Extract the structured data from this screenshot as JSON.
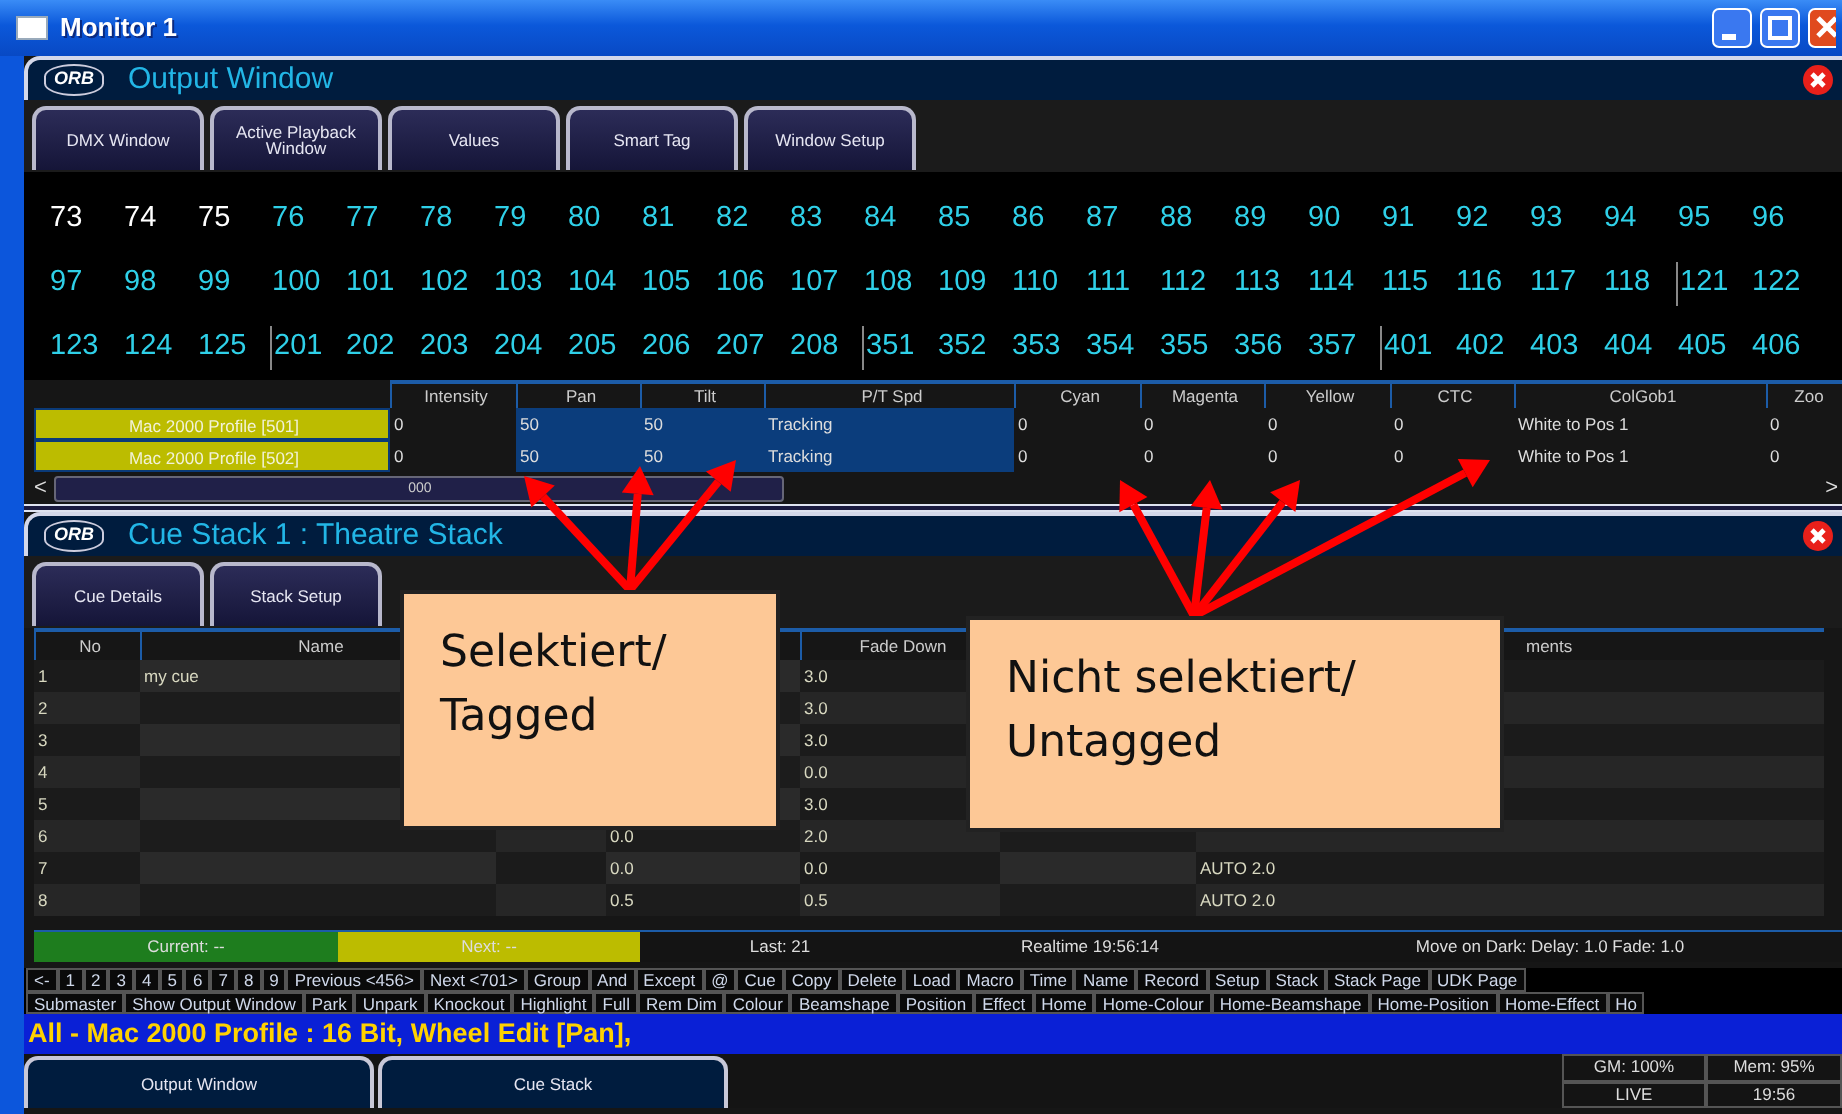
{
  "window": {
    "title": "Monitor 1"
  },
  "output_window": {
    "logo": "ORB",
    "title": "Output Window",
    "buttons": [
      "DMX Window",
      "Active Playback Window",
      "Values",
      "Smart Tag",
      "Window Setup"
    ],
    "channel_rows": [
      [
        {
          "n": "73",
          "color": "#ffffff"
        },
        {
          "n": "74",
          "color": "#ffffff"
        },
        {
          "n": "75",
          "color": "#ffffff"
        },
        {
          "n": "76",
          "color": "#2fd0e8"
        },
        {
          "n": "77",
          "color": "#2fd0e8"
        },
        {
          "n": "78",
          "color": "#2fd0e8"
        },
        {
          "n": "79",
          "color": "#2fd0e8"
        },
        {
          "n": "80",
          "color": "#2fd0e8"
        },
        {
          "n": "81",
          "color": "#2fd0e8"
        },
        {
          "n": "82",
          "color": "#2fd0e8"
        },
        {
          "n": "83",
          "color": "#2fd0e8"
        },
        {
          "n": "84",
          "color": "#2fd0e8"
        },
        {
          "n": "85",
          "color": "#2fd0e8"
        },
        {
          "n": "86",
          "color": "#2fd0e8"
        },
        {
          "n": "87",
          "color": "#2fd0e8"
        },
        {
          "n": "88",
          "color": "#2fd0e8"
        },
        {
          "n": "89",
          "color": "#2fd0e8"
        },
        {
          "n": "90",
          "color": "#2fd0e8"
        },
        {
          "n": "91",
          "color": "#2fd0e8"
        },
        {
          "n": "92",
          "color": "#2fd0e8"
        },
        {
          "n": "93",
          "color": "#2fd0e8"
        },
        {
          "n": "94",
          "color": "#2fd0e8"
        },
        {
          "n": "95",
          "color": "#2fd0e8"
        },
        {
          "n": "96",
          "color": "#2fd0e8"
        }
      ],
      [
        {
          "n": "97",
          "color": "#2fd0e8"
        },
        {
          "n": "98",
          "color": "#2fd0e8"
        },
        {
          "n": "99",
          "color": "#2fd0e8"
        },
        {
          "n": "100",
          "color": "#2fd0e8"
        },
        {
          "n": "101",
          "color": "#2fd0e8"
        },
        {
          "n": "102",
          "color": "#2fd0e8"
        },
        {
          "n": "103",
          "color": "#2fd0e8"
        },
        {
          "n": "104",
          "color": "#2fd0e8"
        },
        {
          "n": "105",
          "color": "#2fd0e8"
        },
        {
          "n": "106",
          "color": "#2fd0e8"
        },
        {
          "n": "107",
          "color": "#2fd0e8"
        },
        {
          "n": "108",
          "color": "#2fd0e8"
        },
        {
          "n": "109",
          "color": "#2fd0e8"
        },
        {
          "n": "110",
          "color": "#2fd0e8"
        },
        {
          "n": "111",
          "color": "#2fd0e8"
        },
        {
          "n": "112",
          "color": "#2fd0e8"
        },
        {
          "n": "113",
          "color": "#2fd0e8"
        },
        {
          "n": "114",
          "color": "#2fd0e8"
        },
        {
          "n": "115",
          "color": "#2fd0e8"
        },
        {
          "n": "116",
          "color": "#2fd0e8"
        },
        {
          "n": "117",
          "color": "#2fd0e8"
        },
        {
          "n": "118",
          "color": "#2fd0e8"
        },
        {
          "n": "121",
          "color": "#2fd0e8",
          "group_start": true
        },
        {
          "n": "122",
          "color": "#2fd0e8"
        }
      ],
      [
        {
          "n": "123",
          "color": "#2fd0e8"
        },
        {
          "n": "124",
          "color": "#2fd0e8"
        },
        {
          "n": "125",
          "color": "#2fd0e8"
        },
        {
          "n": "201",
          "color": "#2fd0e8",
          "group_start": true
        },
        {
          "n": "202",
          "color": "#2fd0e8"
        },
        {
          "n": "203",
          "color": "#2fd0e8"
        },
        {
          "n": "204",
          "color": "#2fd0e8"
        },
        {
          "n": "205",
          "color": "#2fd0e8"
        },
        {
          "n": "206",
          "color": "#2fd0e8"
        },
        {
          "n": "207",
          "color": "#2fd0e8"
        },
        {
          "n": "208",
          "color": "#2fd0e8"
        },
        {
          "n": "351",
          "color": "#2fd0e8",
          "group_start": true
        },
        {
          "n": "352",
          "color": "#2fd0e8"
        },
        {
          "n": "353",
          "color": "#2fd0e8"
        },
        {
          "n": "354",
          "color": "#2fd0e8"
        },
        {
          "n": "355",
          "color": "#2fd0e8"
        },
        {
          "n": "356",
          "color": "#2fd0e8"
        },
        {
          "n": "357",
          "color": "#2fd0e8"
        },
        {
          "n": "401",
          "color": "#2fd0e8",
          "group_start": true
        },
        {
          "n": "402",
          "color": "#2fd0e8"
        },
        {
          "n": "403",
          "color": "#2fd0e8"
        },
        {
          "n": "404",
          "color": "#2fd0e8"
        },
        {
          "n": "405",
          "color": "#2fd0e8"
        },
        {
          "n": "406",
          "color": "#2fd0e8"
        }
      ]
    ],
    "fixture_table": {
      "columns": [
        "Intensity",
        "Pan",
        "Tilt",
        "P/T Spd",
        "Cyan",
        "Magenta",
        "Yellow",
        "CTC",
        "ColGob1",
        "Zoo"
      ],
      "rows": [
        {
          "name": "Mac 2000 Profile [501]",
          "cells": [
            {
              "value": "0",
              "tagged": false
            },
            {
              "value": "50",
              "tagged": true
            },
            {
              "value": "50",
              "tagged": true
            },
            {
              "value": "Tracking",
              "tagged": true
            },
            {
              "value": "0",
              "tagged": false
            },
            {
              "value": "0",
              "tagged": false
            },
            {
              "value": "0",
              "tagged": false
            },
            {
              "value": "0",
              "tagged": false
            },
            {
              "value": "White to Pos 1",
              "tagged": false
            },
            {
              "value": "0",
              "tagged": false
            }
          ]
        },
        {
          "name": "Mac 2000 Profile [502]",
          "cells": [
            {
              "value": "0",
              "tagged": false
            },
            {
              "value": "50",
              "tagged": true
            },
            {
              "value": "50",
              "tagged": true
            },
            {
              "value": "Tracking",
              "tagged": true
            },
            {
              "value": "0",
              "tagged": false
            },
            {
              "value": "0",
              "tagged": false
            },
            {
              "value": "0",
              "tagged": false
            },
            {
              "value": "0",
              "tagged": false
            },
            {
              "value": "White to Pos 1",
              "tagged": false
            },
            {
              "value": "0",
              "tagged": false
            }
          ]
        }
      ]
    },
    "scroll": {
      "left": "<",
      "thumb": "000",
      "right": ">"
    }
  },
  "cue_stack": {
    "logo": "ORB",
    "title": "Cue Stack 1 : Theatre Stack",
    "buttons": [
      "Cue Details",
      "Stack Setup"
    ],
    "columns": [
      "No",
      "Name",
      null,
      null,
      "Fade Down",
      null,
      "ments"
    ],
    "rows": [
      [
        "1",
        "my cue",
        null,
        null,
        "3.0",
        null,
        null
      ],
      [
        "2",
        null,
        null,
        null,
        "3.0",
        null,
        null
      ],
      [
        "3",
        null,
        null,
        null,
        "3.0",
        null,
        null
      ],
      [
        "4",
        null,
        null,
        null,
        "0.0",
        null,
        null
      ],
      [
        "5",
        null,
        null,
        null,
        "3.0",
        null,
        null
      ],
      [
        "6",
        null,
        null,
        "0.0",
        "2.0",
        null,
        null
      ],
      [
        "7",
        null,
        null,
        "0.0",
        "0.0",
        null,
        "AUTO 2.0"
      ],
      [
        "8",
        null,
        null,
        "0.5",
        "0.5",
        null,
        "AUTO 2.0"
      ]
    ],
    "status": {
      "current": "Current: --",
      "next": "Next: --",
      "last": "Last: 21",
      "realtime": "Realtime 19:56:14",
      "move_on_dark": "Move on Dark: Delay: 1.0  Fade: 1.0"
    }
  },
  "softkeys": [
    [
      "<-",
      "1",
      "2",
      "3",
      "4",
      "5",
      "6",
      "7",
      "8",
      "9",
      "Previous <456>",
      "Next <701>",
      "Group",
      "And",
      "Except",
      "@",
      "Cue",
      "Copy",
      "Delete",
      "Load",
      "Macro",
      "Time",
      "Name",
      "Record",
      "Setup",
      "Stack",
      "Stack Page",
      "UDK Page"
    ],
    [
      "Submaster",
      "Show Output Window",
      "Park",
      "Unpark",
      "Knockout",
      "Highlight",
      "Full",
      "Rem Dim",
      "Colour",
      "Beamshape",
      "Position",
      "Effect",
      "Home",
      "Home-Colour",
      "Home-Beamshape",
      "Home-Position",
      "Home-Effect",
      "Ho"
    ]
  ],
  "command_line": "All - Mac 2000 Profile : 16 Bit, Wheel Edit [Pan],",
  "window_tabs": [
    "Output Window",
    "Cue Stack"
  ],
  "indicators": {
    "gm": "GM: 100%",
    "mem": "Mem: 95%",
    "mode": "LIVE",
    "clock": "19:56"
  },
  "annotations": [
    {
      "text": "Selektiert/ Tagged"
    },
    {
      "text": "Nicht selektiert/ Untagged"
    }
  ]
}
